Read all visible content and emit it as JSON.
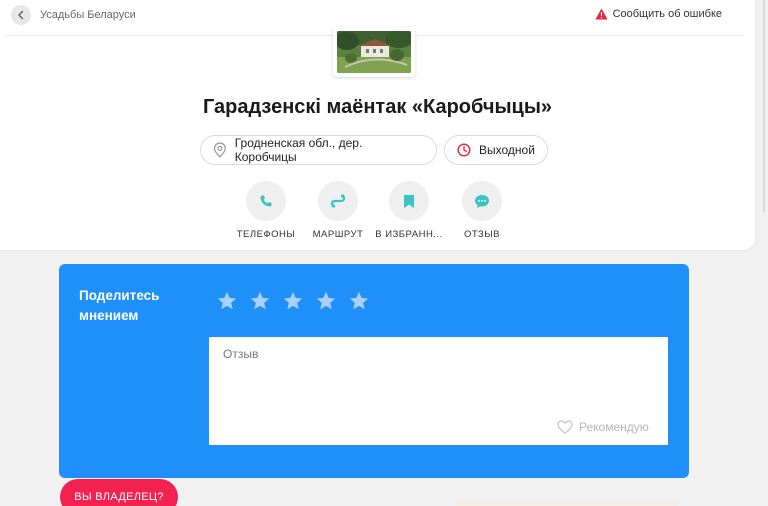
{
  "header": {
    "breadcrumb": "Усадьбы Беларуси",
    "report_label": "Сообщить об ошибке",
    "title": "Гарадзенскі маёнтак «Каробчыцы»"
  },
  "chips": {
    "address": "Гродненская обл., дер. Коробчицы",
    "status": "Выходной"
  },
  "actions": [
    {
      "label": "ТЕЛЕФОНЫ",
      "icon": "phone-icon"
    },
    {
      "label": "МАРШРУТ",
      "icon": "route-icon"
    },
    {
      "label": "В ИЗБРАНН...",
      "icon": "bookmark-icon"
    },
    {
      "label": "ОТЗЫВ",
      "icon": "comment-icon"
    }
  ],
  "review": {
    "title": "Поделитесь мнением",
    "rating_max": 5,
    "rating": 0,
    "placeholder": "Отзыв",
    "recommend_label": "Рекомендую"
  },
  "owner_button": "ВЫ ВЛАДЕЛЕЦ?",
  "colors": {
    "accent_teal": "#3ac3c4",
    "review_blue": "#1f8ff9",
    "owner_pink": "#f32150",
    "warning_red": "#e8253a"
  }
}
